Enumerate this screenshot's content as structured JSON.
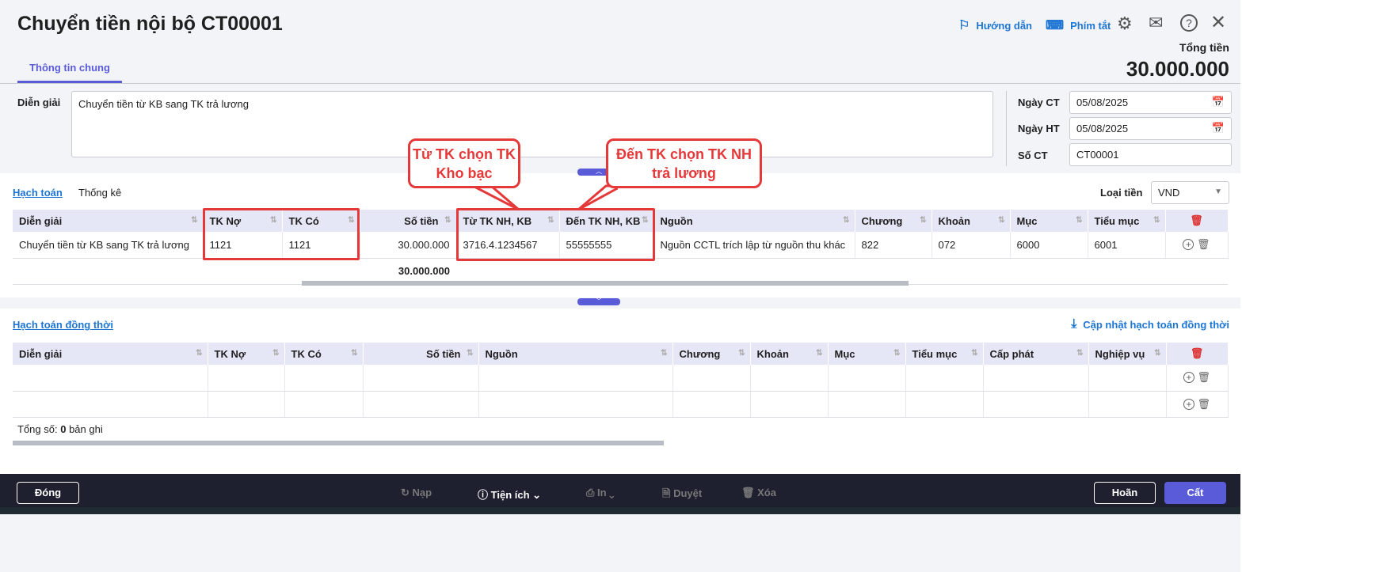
{
  "header": {
    "title": "Chuyển tiền nội bộ CT00001",
    "guide": "Hướng dẫn",
    "shortcuts": "Phím tắt",
    "total_label": "Tổng tiền",
    "total_value": "30.000.000",
    "tab": "Thông tin chung"
  },
  "form": {
    "desc_label": "Diễn giải",
    "desc_value": "Chuyển tiền từ KB sang TK trả lương",
    "ngay_ct_label": "Ngày CT",
    "ngay_ct": "05/08/2025",
    "ngay_ht_label": "Ngày HT",
    "ngay_ht": "05/08/2025",
    "so_ct_label": "Số CT",
    "so_ct": "CT00001"
  },
  "callouts": {
    "left": "Từ TK chọn TK Kho bạc",
    "right": "Đến TK chọn TK NH trả lương",
    "color": "#e53939"
  },
  "ledger": {
    "tab_active": "Hạch toán",
    "tab_other": "Thống kê",
    "currency_label": "Loại tiền",
    "currency": "VND",
    "columns": [
      "Diễn giải",
      "TK Nợ",
      "TK Có",
      "Số tiền",
      "Từ TK NH, KB",
      "Đến TK NH, KB",
      "Nguồn",
      "Chương",
      "Khoản",
      "Mục",
      "Tiểu mục"
    ],
    "rows": [
      [
        "Chuyển tiền từ KB sang TK trả lương",
        "1121",
        "1121",
        "30.000.000",
        "3716.4.1234567",
        "55555555",
        "Nguồn CCTL trích lập từ nguồn thu khác",
        "822",
        "072",
        "6000",
        "6001"
      ]
    ],
    "total": "30.000.000"
  },
  "simul": {
    "title": "Hạch toán đồng thời",
    "update": "Cập nhật hạch toán đồng thời",
    "columns": [
      "Diễn giải",
      "TK Nợ",
      "TK Có",
      "Số tiền",
      "Nguồn",
      "Chương",
      "Khoản",
      "Mục",
      "Tiểu mục",
      "Cấp phát",
      "Nghiệp vụ"
    ],
    "row_count": 2,
    "count_label": "Tổng số:",
    "count": "0",
    "count_suffix": "bản ghi"
  },
  "footer": {
    "close": "Đóng",
    "reload": "Nạp",
    "utilities": "Tiện ích",
    "print": "In",
    "approve": "Duyệt",
    "delete": "Xóa",
    "undo": "Hoãn",
    "save": "Cất",
    "accent": "#5a5bd9"
  }
}
